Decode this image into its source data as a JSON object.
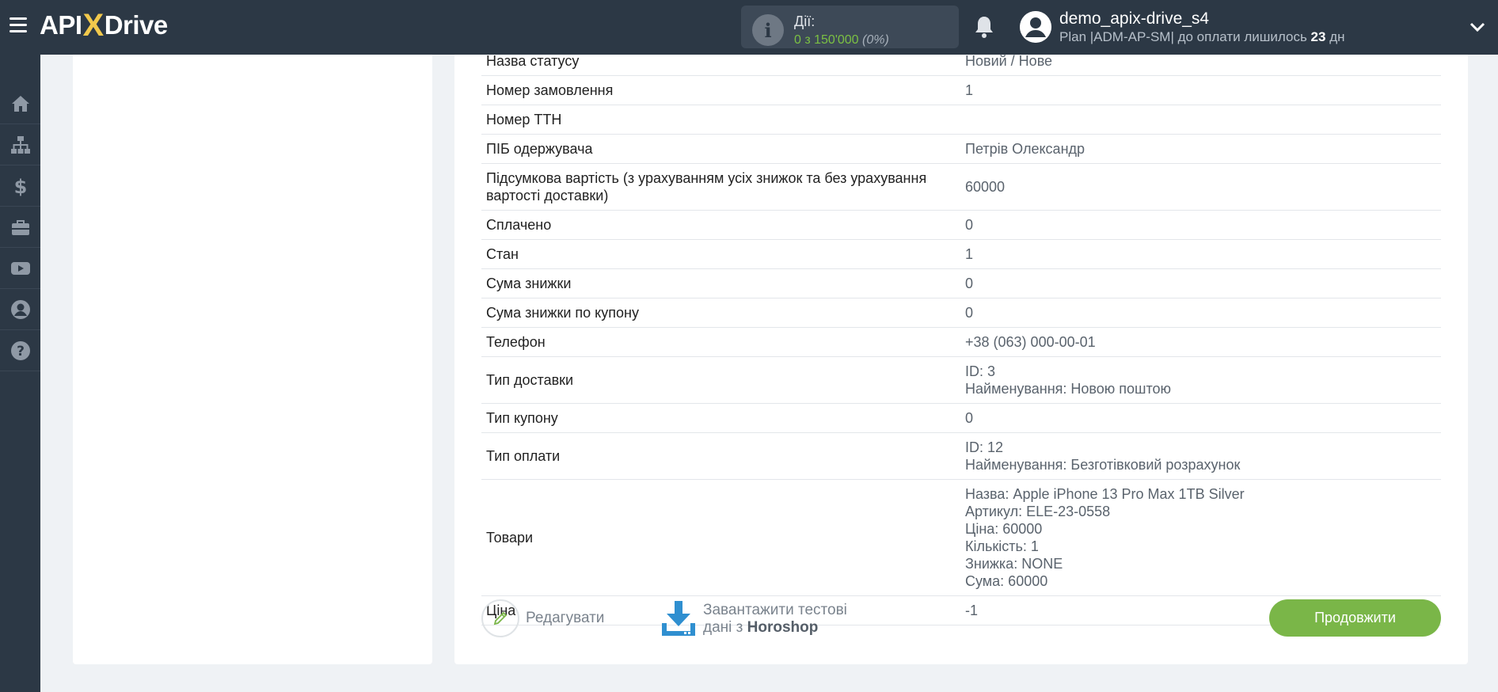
{
  "header": {
    "logo_left": "API",
    "logo_x": "X",
    "logo_right": "Drive",
    "actions_label": "Дії:",
    "actions_count": "0 з 150'000",
    "actions_percent": "(0%)",
    "user_name": "demo_apix-drive_s4",
    "plan_text": "Plan |ADM-AP-SM| до оплати лишилось ",
    "plan_days": "23",
    "plan_suffix": " дн"
  },
  "sidebar": {
    "items": [
      {
        "icon": "home-icon"
      },
      {
        "icon": "sitemap-icon"
      },
      {
        "icon": "dollar-icon"
      },
      {
        "icon": "briefcase-icon"
      },
      {
        "icon": "youtube-icon"
      },
      {
        "icon": "user-icon"
      },
      {
        "icon": "help-icon"
      }
    ]
  },
  "table": {
    "rows": [
      {
        "key": "Назва статусу",
        "value": "Новий / Нове"
      },
      {
        "key": "Номер замовлення",
        "value": "1"
      },
      {
        "key": "Номер ТТН",
        "value": ""
      },
      {
        "key": "ПІБ одержувача",
        "value": "Петрів Олександр"
      },
      {
        "key": "Підсумкова вартість (з урахуванням усіх знижок та без урахування вартості доставки)",
        "value": "60000"
      },
      {
        "key": "Сплачено",
        "value": "0"
      },
      {
        "key": "Стан",
        "value": "1"
      },
      {
        "key": "Сума знижки",
        "value": "0"
      },
      {
        "key": "Сума знижки по купону",
        "value": "0"
      },
      {
        "key": "Телефон",
        "value": "+38 (063) 000-00-01"
      },
      {
        "key": "Тип доставки",
        "value": "ID: 3\nНайменування: Новою поштою"
      },
      {
        "key": "Тип купону",
        "value": "0"
      },
      {
        "key": "Тип оплати",
        "value": "ID: 12\nНайменування: Безготівковий розрахунок"
      },
      {
        "key": "Товари",
        "value": "Назва: Apple iPhone 13 Pro Max 1TB Silver\nАртикул: ELE-23-0558\nЦіна: 60000\nКількість: 1\nЗнижка: NONE\nСума: 60000"
      },
      {
        "key": "Ціна",
        "value": "-1"
      }
    ]
  },
  "footer": {
    "edit_label": "Редагувати",
    "download_line1": "Завантажити тестові",
    "download_line2_prefix": "дані з ",
    "download_source": "Horoshop",
    "continue_label": "Продовжити"
  },
  "colors": {
    "topbar": "#2c3845",
    "accent_green": "#7ab648",
    "download_blue": "#2f8fd0"
  }
}
